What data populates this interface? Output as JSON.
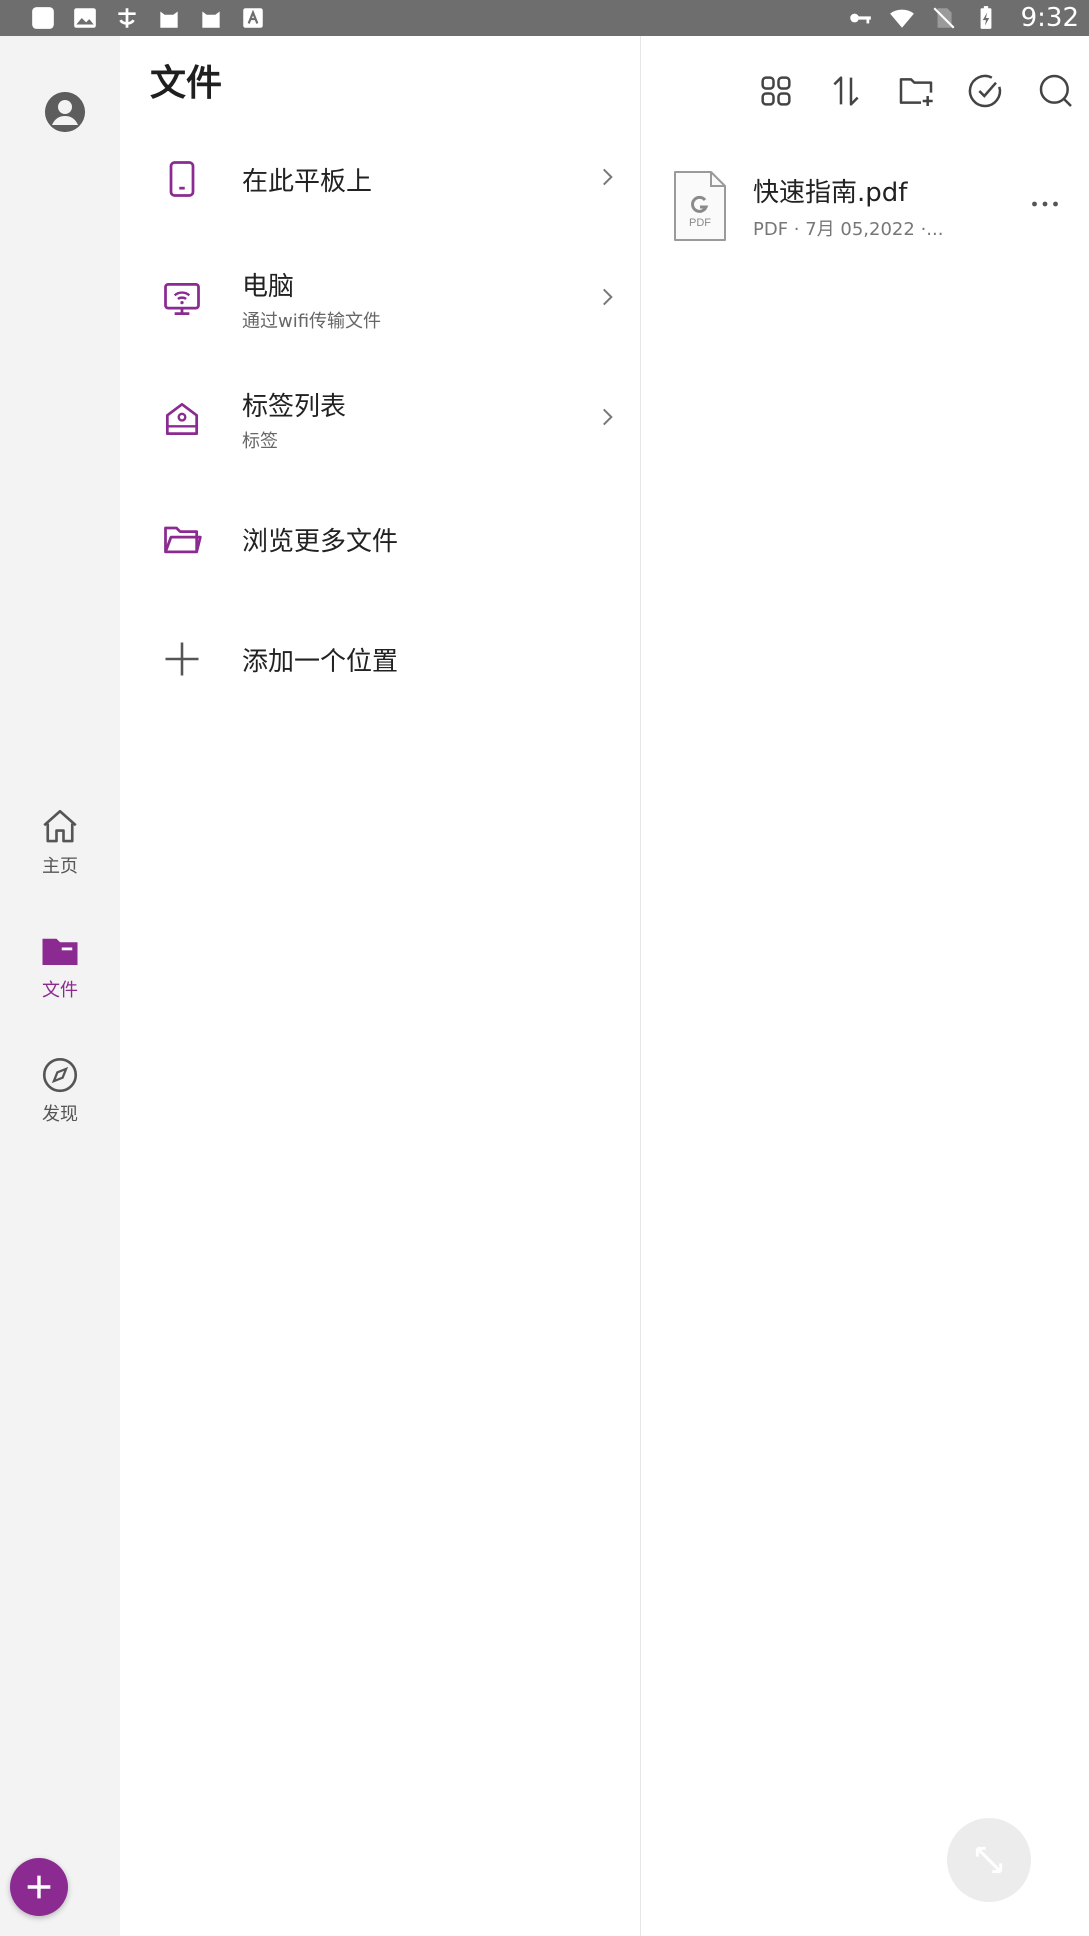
{
  "status_bar": {
    "time": "9:32",
    "left_icons": [
      "app-icon",
      "gallery-icon",
      "app2-icon",
      "cat-icon",
      "cat-icon",
      "text-app-icon"
    ],
    "right_icons": [
      "key-icon",
      "wifi-icon",
      "no-sim-icon",
      "battery-charging-icon"
    ]
  },
  "rail": {
    "items": [
      {
        "label": "主页",
        "icon": "home-icon"
      },
      {
        "label": "文件",
        "icon": "folder-icon",
        "active": true
      },
      {
        "label": "发现",
        "icon": "compass-icon"
      }
    ],
    "fab_icon": "plus-icon"
  },
  "middle": {
    "title": "文件",
    "locations": [
      {
        "label": "在此平板上",
        "sub": "",
        "icon": "tablet-icon",
        "chevron": true
      },
      {
        "label": "电脑",
        "sub": "通过wifi传输文件",
        "icon": "monitor-wifi-icon",
        "chevron": true
      },
      {
        "label": "标签列表",
        "sub": "标签",
        "icon": "tag-icon",
        "chevron": true
      },
      {
        "label": "浏览更多文件",
        "sub": "",
        "icon": "folder-open-icon",
        "chevron": false
      },
      {
        "label": "添加一个位置",
        "sub": "",
        "icon": "plus-icon",
        "chevron": false
      }
    ]
  },
  "toolbar": {
    "buttons": [
      "grid-view-icon",
      "sort-icon",
      "new-folder-icon",
      "select-icon",
      "search-icon"
    ]
  },
  "files": [
    {
      "name": "快速指南.pdf",
      "meta": "PDF · 7月 05,2022 ·..."
    }
  ],
  "colors": {
    "accent": "#8b2b92",
    "status_bar": "#6e6e6e",
    "rail_bg": "#f3f3f3"
  }
}
